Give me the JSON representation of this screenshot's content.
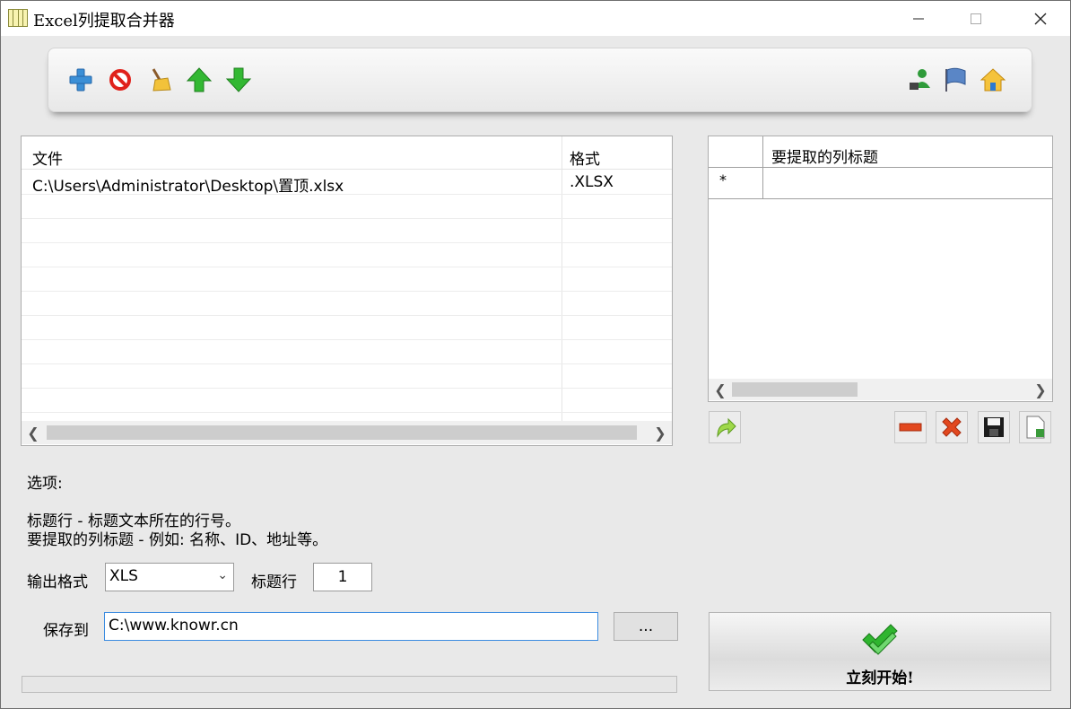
{
  "window": {
    "title": "Excel列提取合并器"
  },
  "toolbar": {
    "left_icons": [
      "add-icon",
      "remove-icon",
      "clear-icon",
      "move-up-icon",
      "move-down-icon"
    ],
    "right_icons": [
      "user-icon",
      "flag-icon",
      "home-icon"
    ]
  },
  "file_list": {
    "columns": [
      "文件",
      "格式"
    ],
    "rows": [
      {
        "file": "C:\\Users\\Administrator\\Desktop\\置顶.xlsx",
        "format": ".XLSX"
      }
    ]
  },
  "columns_grid": {
    "header": "要提取的列标题",
    "new_row_marker": "*"
  },
  "options": {
    "heading": "选项:",
    "help_line1": "标题行 - 标题文本所在的行号。",
    "help_line2": "要提取的列标题 - 例如: 名称、ID、地址等。",
    "output_format_label": "输出格式",
    "output_format_value": "XLS",
    "header_row_label": "标题行",
    "header_row_value": "1",
    "save_to_label": "保存到",
    "save_to_value": "C:\\www.knowr.cn",
    "browse_label": "...",
    "start_label": "立刻开始!"
  },
  "colors": {
    "accent_blue": "#3c8ce0",
    "green": "#2aa52a",
    "red": "#e23b1f"
  }
}
